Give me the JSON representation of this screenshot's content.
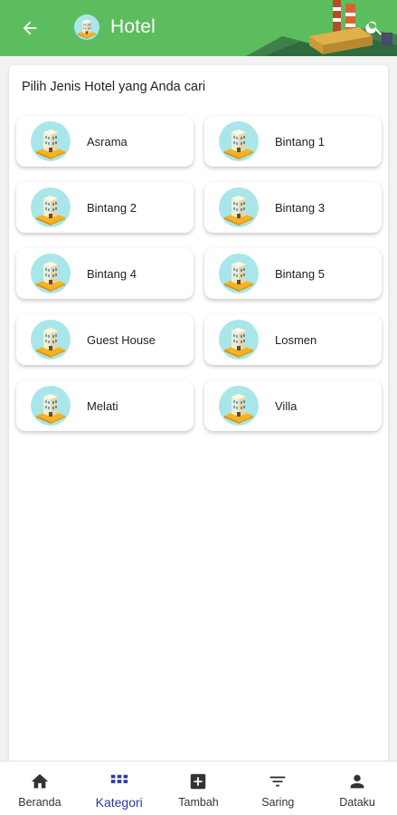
{
  "appbar": {
    "title": "Hotel",
    "back_icon": "arrow-left-icon",
    "title_icon": "hotel-icon",
    "search_icon": "search-icon",
    "color": "#5cbd5e"
  },
  "main": {
    "heading": "Pilih Jenis Hotel yang Anda cari",
    "categories": [
      {
        "label": "Asrama"
      },
      {
        "label": "Bintang 1"
      },
      {
        "label": "Bintang 2"
      },
      {
        "label": "Bintang 3"
      },
      {
        "label": "Bintang 4"
      },
      {
        "label": "Bintang 5"
      },
      {
        "label": "Guest House"
      },
      {
        "label": "Losmen"
      },
      {
        "label": "Melati"
      },
      {
        "label": "Villa"
      }
    ]
  },
  "bottom_nav": {
    "active_color": "#2a3a9e",
    "items": [
      {
        "label": "Beranda",
        "icon": "home-icon"
      },
      {
        "label": "Kategori",
        "icon": "grid-icon"
      },
      {
        "label": "Tambah",
        "icon": "add-box-icon"
      },
      {
        "label": "Saring",
        "icon": "filter-icon"
      },
      {
        "label": "Dataku",
        "icon": "person-icon"
      }
    ]
  }
}
